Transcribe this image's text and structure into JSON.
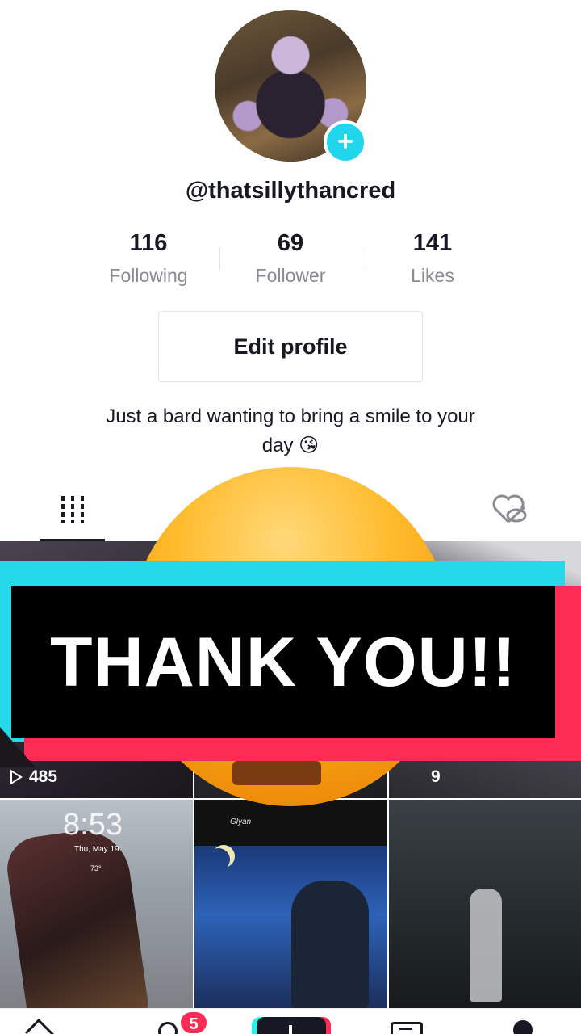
{
  "profile": {
    "username": "@thatsillythancred",
    "stats": [
      {
        "value": "116",
        "label": "Following"
      },
      {
        "value": "69",
        "label": "Follower"
      },
      {
        "value": "141",
        "label": "Likes"
      }
    ],
    "edit_button": "Edit profile",
    "bio_line1": "Just a bard wanting to bring a smile to your",
    "bio_line2": "day 😘"
  },
  "tabs": {
    "videos_icon": "grid-icon",
    "liked_icon": "private-liked-icon"
  },
  "videos": [
    {
      "views": "485"
    },
    {
      "views": ""
    },
    {
      "views": "9"
    },
    {
      "lock_time": "8:53",
      "lock_date": "Thu, May 19",
      "lock_temp": "73°"
    },
    {
      "caption": "Glyan"
    },
    {}
  ],
  "overlay": {
    "banner_text": "THANK YOU!!",
    "colors": {
      "cyan": "#25d8ea",
      "red": "#fd2c55",
      "black": "#000000",
      "emoji": "#ffbb2d"
    }
  },
  "nav": {
    "items": [
      "home-icon",
      "friends-icon",
      "create-icon",
      "inbox-icon",
      "profile-icon"
    ],
    "friends_badge": "5"
  }
}
